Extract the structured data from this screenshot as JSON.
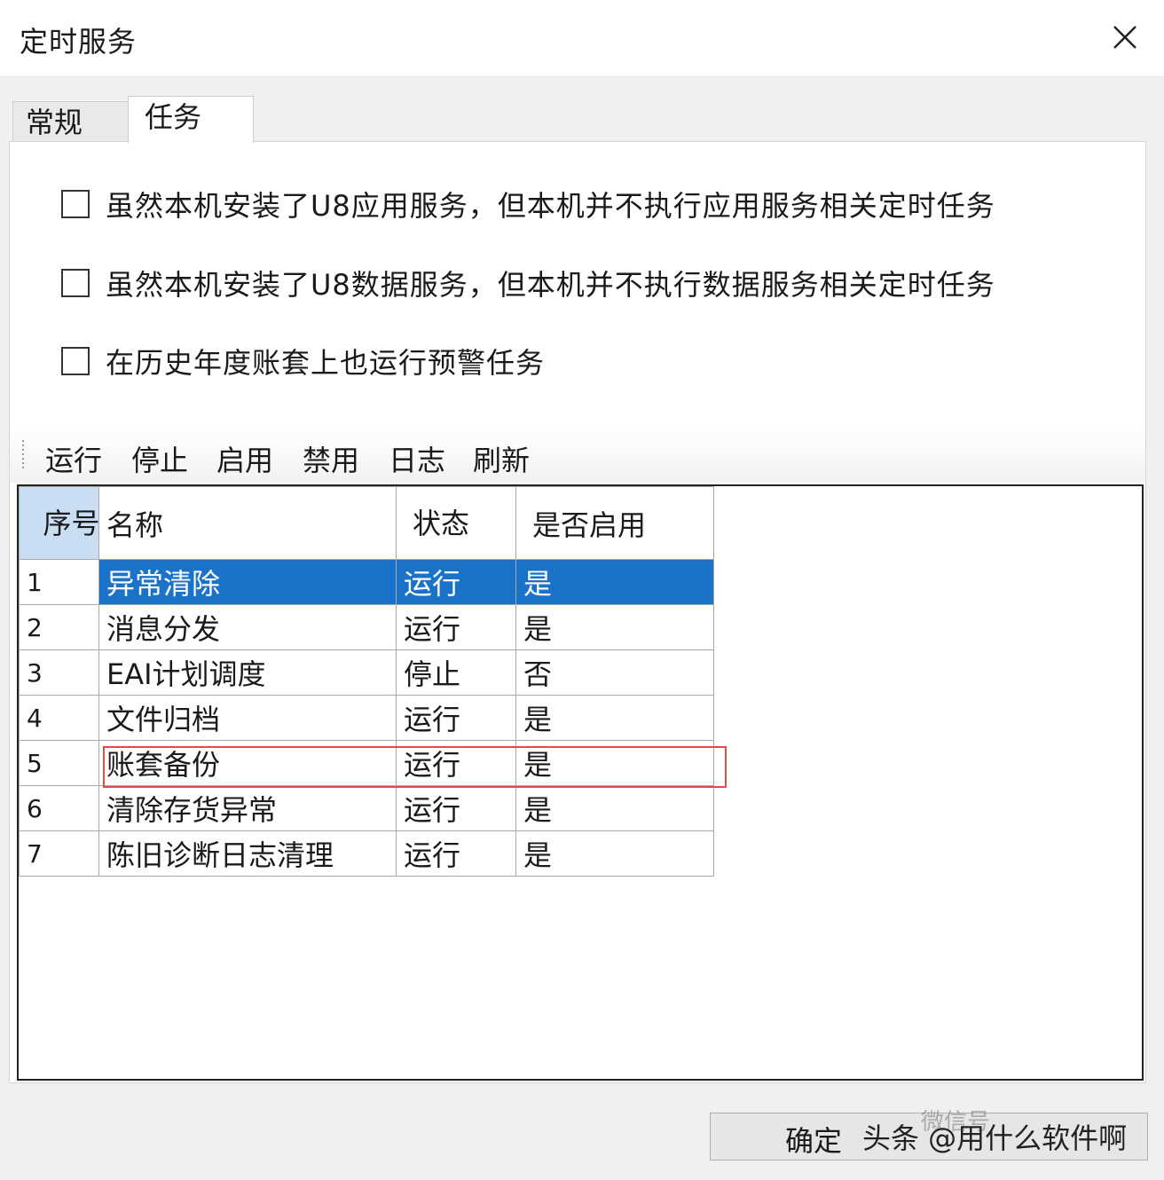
{
  "window": {
    "title": "定时服务"
  },
  "tabs": [
    {
      "label": "常规",
      "active": false
    },
    {
      "label": "任务",
      "active": true
    }
  ],
  "options": [
    {
      "label": "虽然本机安装了U8应用服务，但本机并不执行应用服务相关定时任务",
      "checked": false
    },
    {
      "label": "虽然本机安装了U8数据服务，但本机并不执行数据服务相关定时任务",
      "checked": false
    },
    {
      "label": "在历史年度账套上也运行预警任务",
      "checked": false
    }
  ],
  "toolbar": {
    "run": "运行",
    "stop": "停止",
    "enable": "启用",
    "disable": "禁用",
    "log": "日志",
    "refresh": "刷新"
  },
  "table": {
    "headers": {
      "seq": "序号",
      "name": "名称",
      "status": "状态",
      "enabled": "是否启用"
    },
    "rows": [
      {
        "seq": "1",
        "name": "异常清除",
        "status": "运行",
        "enabled": "是"
      },
      {
        "seq": "2",
        "name": "消息分发",
        "status": "运行",
        "enabled": "是"
      },
      {
        "seq": "3",
        "name": "EAI计划调度",
        "status": "停止",
        "enabled": "否"
      },
      {
        "seq": "4",
        "name": "文件归档",
        "status": "运行",
        "enabled": "是"
      },
      {
        "seq": "5",
        "name": "账套备份",
        "status": "运行",
        "enabled": "是"
      },
      {
        "seq": "6",
        "name": "清除存货异常",
        "status": "运行",
        "enabled": "是"
      },
      {
        "seq": "7",
        "name": "陈旧诊断日志清理",
        "status": "运行",
        "enabled": "是"
      }
    ],
    "selected_row": 1,
    "highlighted_row": 5
  },
  "buttons": {
    "ok": "确定"
  },
  "watermark": {
    "text": "头条 @用什么软件啊",
    "faint": "微信号"
  },
  "colors": {
    "selection": "#1b73c9",
    "highlight_box": "#e34a4a",
    "header_seq": "#c9def3"
  }
}
